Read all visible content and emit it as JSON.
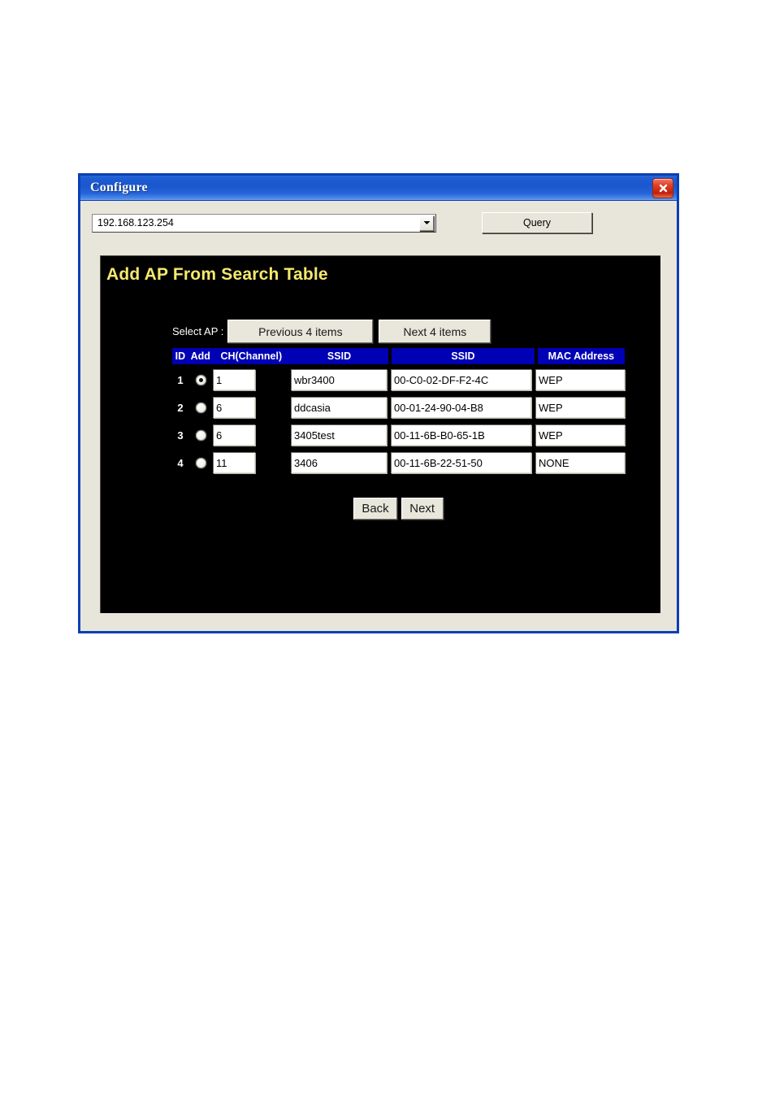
{
  "window": {
    "title": "Configure",
    "close_icon": "close-icon"
  },
  "toolbar": {
    "ip_selected": "192.168.123.254",
    "dropdown_icon": "chevron-down-icon",
    "query_label": "Query"
  },
  "page": {
    "heading": "Add AP From Search Table",
    "select_ap_label": "Select AP :",
    "prev_items_label": "Previous 4 items",
    "next_items_label": "Next 4 items"
  },
  "table": {
    "headers": {
      "id": "ID",
      "add": "Add",
      "channel": "CH(Channel)",
      "ssid1": "SSID",
      "ssid2": "SSID",
      "mac": "MAC Address"
    },
    "rows": [
      {
        "id": "1",
        "selected": true,
        "channel": "1",
        "ssid": "wbr3400",
        "mac": "00-C0-02-DF-F2-4C",
        "security": "WEP"
      },
      {
        "id": "2",
        "selected": false,
        "channel": "6",
        "ssid": "ddcasia",
        "mac": "00-01-24-90-04-B8",
        "security": "WEP"
      },
      {
        "id": "3",
        "selected": false,
        "channel": "6",
        "ssid": "3405test",
        "mac": "00-11-6B-B0-65-1B",
        "security": "WEP"
      },
      {
        "id": "4",
        "selected": false,
        "channel": "11",
        "ssid": "3406",
        "mac": "00-11-6B-22-51-50",
        "security": "NONE"
      }
    ]
  },
  "footer": {
    "back_label": "Back",
    "next_label": "Next"
  },
  "colors": {
    "title_bar_blue": "#1a56cd",
    "heading_yellow": "#f5e96b",
    "table_header_blue": "#0000b4",
    "panel_black": "#000000",
    "window_face": "#e8e6db",
    "close_red": "#c41f08"
  }
}
